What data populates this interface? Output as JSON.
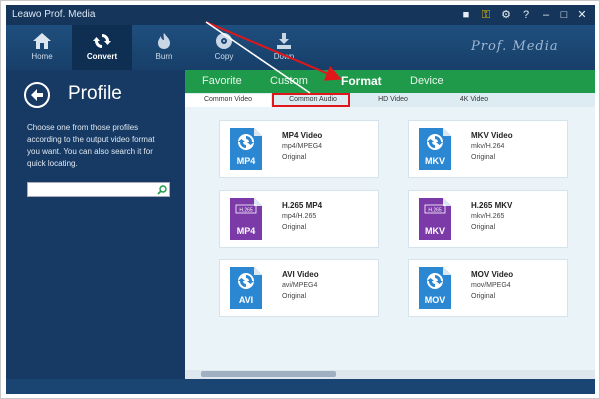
{
  "app": {
    "title": "Leawo Prof. Media",
    "brand": "Prof. Media"
  },
  "nav": [
    {
      "label": "Home",
      "icon": "home-icon"
    },
    {
      "label": "Convert",
      "icon": "convert-icon"
    },
    {
      "label": "Burn",
      "icon": "burn-icon"
    },
    {
      "label": "Copy",
      "icon": "copy-icon"
    },
    {
      "label": "Down",
      "icon": "download-icon"
    }
  ],
  "profile": {
    "title": "Profile",
    "description": "Choose one from those profiles according to the output video format you want. You can also search it for quick locating.",
    "search_value": ""
  },
  "tabs": [
    "Favorite",
    "Custom",
    "Format",
    "Device"
  ],
  "active_tab": "Format",
  "subtabs": [
    "Common Video",
    "Common Audio",
    "HD Video",
    "4K Video"
  ],
  "formats": [
    {
      "name": "MP4 Video",
      "codec": "mp4/MPEG4",
      "quality": "Original",
      "badge": "MP4",
      "color": "#2b87d1",
      "hevc": ""
    },
    {
      "name": "MKV Video",
      "codec": "mkv/H.264",
      "quality": "Original",
      "badge": "MKV",
      "color": "#2b87d1",
      "hevc": ""
    },
    {
      "name": "H.265 MP4",
      "codec": "mp4/H.265",
      "quality": "Original",
      "badge": "MP4",
      "color": "#7b3aa8",
      "hevc": "H.265"
    },
    {
      "name": "H.265 MKV",
      "codec": "mkv/H.265",
      "quality": "Original",
      "badge": "MKV",
      "color": "#7b3aa8",
      "hevc": "H.265"
    },
    {
      "name": "AVI Video",
      "codec": "avi/MPEG4",
      "quality": "Original",
      "badge": "AVI",
      "color": "#2b87d1",
      "hevc": ""
    },
    {
      "name": "MOV Video",
      "codec": "mov/MPEG4",
      "quality": "Original",
      "badge": "MOV",
      "color": "#2b87d1",
      "hevc": ""
    }
  ],
  "colors": {
    "accent_green": "#1f9a4a",
    "highlight_red": "#e0161a",
    "nav_blue": "#163a63"
  }
}
